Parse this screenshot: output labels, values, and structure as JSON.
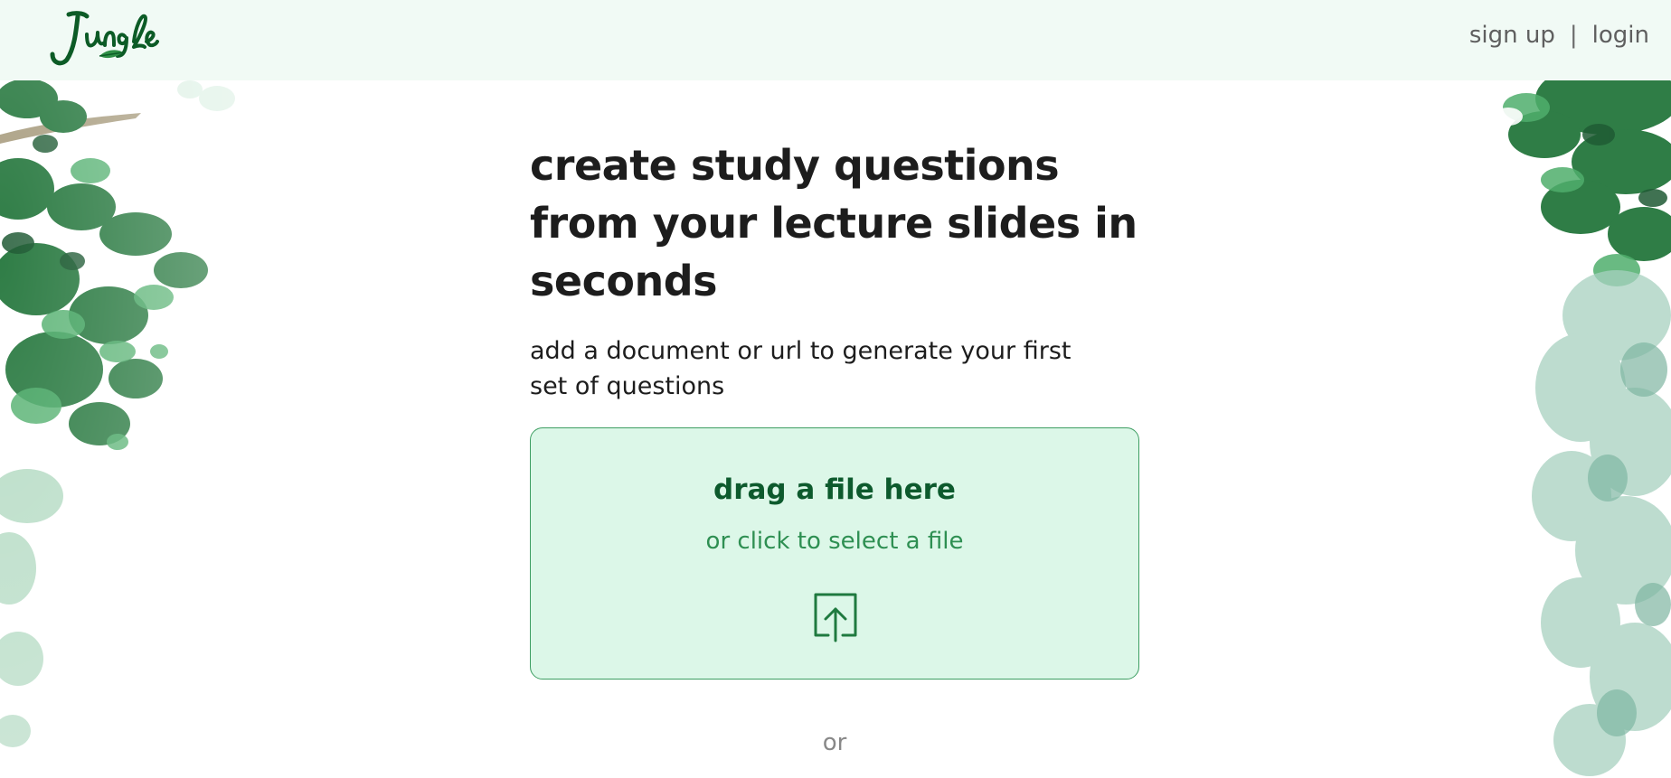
{
  "header": {
    "logo_text": "Jungle",
    "signup_label": "sign up",
    "separator": "|",
    "login_label": "login"
  },
  "hero": {
    "headline_line1": "create study questions",
    "headline_line2": "from your lecture slides in",
    "headline_line3": "seconds",
    "subtitle_line1": "add a document or url to generate your first",
    "subtitle_line2": "set of questions"
  },
  "dropzone": {
    "title": "drag a file here",
    "subtitle": "or click to select a file",
    "icon": "upload-icon"
  },
  "divider": {
    "label": "or"
  },
  "colors": {
    "header_bg": "#f1faf5",
    "dropzone_bg": "#dcf7e8",
    "dropzone_border": "#3d9e62",
    "brand_dark_green": "#0d5a2d",
    "brand_green": "#2e8f52",
    "text_dark": "#1d1d1d",
    "text_muted": "#5f5f5f"
  }
}
